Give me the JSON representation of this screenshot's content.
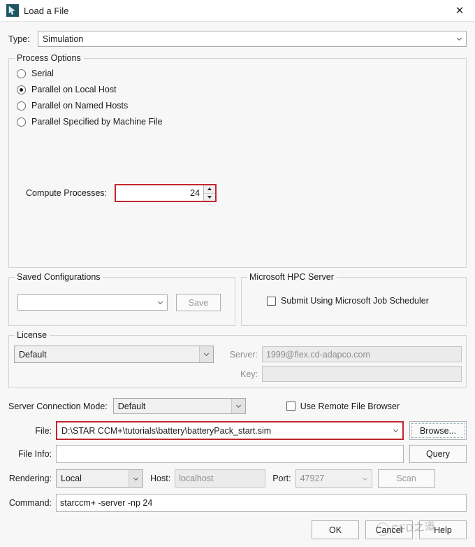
{
  "window": {
    "title": "Load a File",
    "icon": "simulation-file-icon",
    "close_label": "✕"
  },
  "type_row": {
    "label": "Type:",
    "value": "Simulation"
  },
  "process_options": {
    "legend": "Process Options",
    "radios": [
      {
        "label": "Serial",
        "checked": false
      },
      {
        "label": "Parallel on Local Host",
        "checked": true
      },
      {
        "label": "Parallel on Named Hosts",
        "checked": false
      },
      {
        "label": "Parallel Specified by Machine File",
        "checked": false
      }
    ],
    "compute_processes": {
      "label": "Compute Processes:",
      "value": "24",
      "highlight_color": "#c1272d"
    }
  },
  "saved_configurations": {
    "legend": "Saved Configurations",
    "combo_value": "",
    "save_label": "Save"
  },
  "hpc": {
    "legend": "Microsoft HPC Server",
    "checkbox_label": "Submit Using Microsoft Job Scheduler",
    "checked": false
  },
  "license": {
    "legend": "License",
    "combo_value": "Default",
    "server_label": "Server:",
    "server_value": "1999@flex.cd-adapco.com",
    "key_label": "Key:",
    "key_value": ""
  },
  "server_connection": {
    "label": "Server Connection Mode:",
    "value": "Default",
    "remote_browser_label": "Use Remote File Browser",
    "remote_browser_checked": false
  },
  "file_row": {
    "label": "File:",
    "value": "D:\\STAR CCM+\\tutorials\\battery\\batteryPack_start.sim",
    "browse_label": "Browse...",
    "highlight_color": "#c1272d"
  },
  "file_info_row": {
    "label": "File Info:",
    "value": "",
    "query_label": "Query"
  },
  "rendering_row": {
    "label": "Rendering:",
    "value": "Local",
    "host_label": "Host:",
    "host_value": "localhost",
    "port_label": "Port:",
    "port_value": "47927",
    "scan_label": "Scan"
  },
  "command_row": {
    "label": "Command:",
    "value": "starccm+ -server -np 24"
  },
  "footer": {
    "ok_label": "OK",
    "cancel_label": "Cancel",
    "help_label": "Help"
  },
  "watermark": {
    "text": "CFD之道"
  }
}
